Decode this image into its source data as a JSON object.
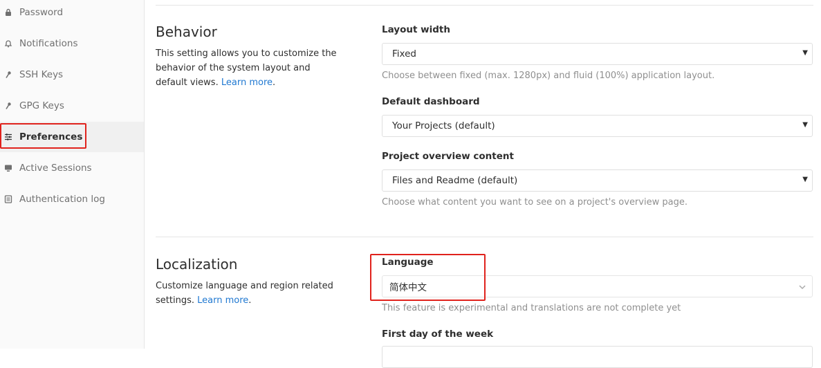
{
  "sidebar": {
    "items": [
      {
        "label": "Password",
        "icon": "lock-icon"
      },
      {
        "label": "Notifications",
        "icon": "bell-icon"
      },
      {
        "label": "SSH Keys",
        "icon": "key-icon"
      },
      {
        "label": "GPG Keys",
        "icon": "key-icon"
      },
      {
        "label": "Preferences",
        "icon": "sliders-icon",
        "active": true
      },
      {
        "label": "Active Sessions",
        "icon": "monitor-icon"
      },
      {
        "label": "Authentication log",
        "icon": "list-icon"
      }
    ]
  },
  "behavior": {
    "title": "Behavior",
    "description": "This setting allows you to customize the behavior of the system layout and default views.",
    "link": "Learn more",
    "layout_width": {
      "label": "Layout width",
      "value": "Fixed",
      "hint": "Choose between fixed (max. 1280px) and fluid (100%) application layout."
    },
    "default_dashboard": {
      "label": "Default dashboard",
      "value": "Your Projects (default)"
    },
    "project_overview": {
      "label": "Project overview content",
      "value": "Files and Readme (default)",
      "hint": "Choose what content you want to see on a project's overview page."
    }
  },
  "localization": {
    "title": "Localization",
    "description": "Customize language and region related settings.",
    "link": "Learn more",
    "language": {
      "label": "Language",
      "value": "简体中文",
      "hint": "This feature is experimental and translations are not complete yet"
    },
    "first_day": {
      "label": "First day of the week"
    }
  },
  "colors": {
    "link": "#1f78d1",
    "highlight": "#e0221c",
    "sidebar_bg": "#fafafa",
    "hint": "#8f8f8f"
  }
}
